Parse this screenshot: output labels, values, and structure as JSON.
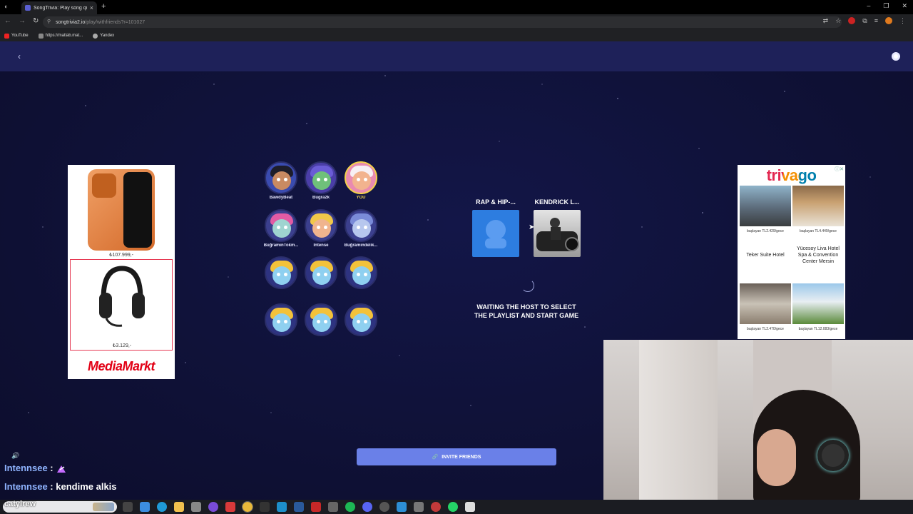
{
  "browser": {
    "tab_title": "SongTrivia: Play song quizzes w",
    "url_host": "songtrivia2.io",
    "url_path": "/play/withfriends?r=101027",
    "bookmarks": [
      "YouTube",
      "https://matlab.mat...",
      "Yandex"
    ]
  },
  "left_ad": {
    "price_phone": "₺107.999,-",
    "price_headphones": "₺3.129,-",
    "brand": "MediaMarkt"
  },
  "right_ad": {
    "brand": "trivago",
    "hotel_prices": [
      "başlayan TL2.429/gece",
      "başlayan TL4.449/gece",
      "başlayan TL2.470/gece",
      "başlayan TL12.083/gece"
    ],
    "hotel_names": [
      "Teker Suite Hotel",
      "Yücesoy Liva Hotel Spa & Convention Center Mersin"
    ]
  },
  "players": [
    {
      "name": "BawdyBeat"
    },
    {
      "name": "Bugra2k"
    },
    {
      "name": "YOU"
    },
    {
      "name": "BuğramınTokm..."
    },
    {
      "name": "Intense"
    },
    {
      "name": "Buğramındelik..."
    }
  ],
  "playlists": [
    {
      "title": "RAP & HIP-..."
    },
    {
      "title": "KENDRICK L..."
    }
  ],
  "status": {
    "waiting_line1": "WAITING THE HOST TO SELECT",
    "waiting_line2": "THE PLAYLIST AND START GAME"
  },
  "invite_label": "INVITE FRIENDS",
  "chat": [
    {
      "user": "Intennsee",
      "sep": " : ",
      "msg": ""
    },
    {
      "user": "Intennsee",
      "sep": " : ",
      "msg": "kendime alkis"
    }
  ],
  "taskbar_user": "catylrew",
  "colors": {
    "page_bg": "#10123a",
    "nav_bg": "#1e2159",
    "accent_button": "#6a80e8",
    "you_highlight": "#f3d34a",
    "mediamarkt_red": "#e20015"
  }
}
